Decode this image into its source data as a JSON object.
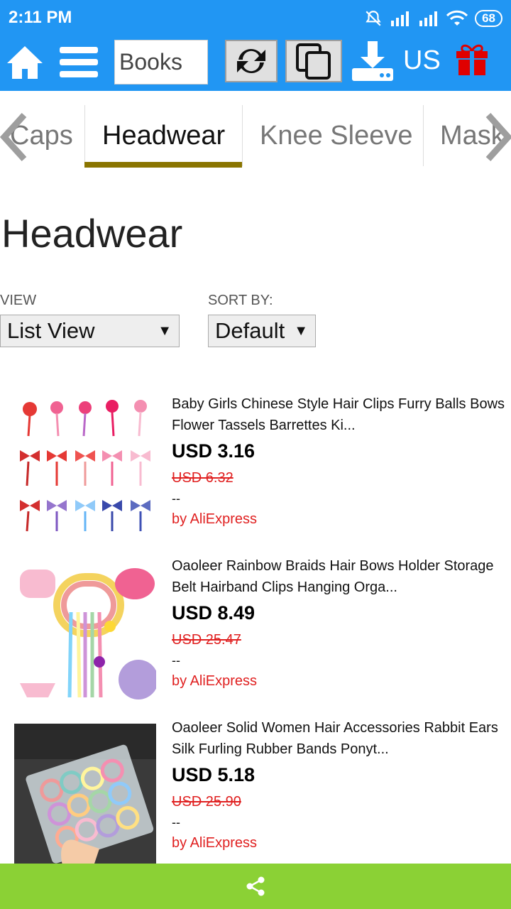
{
  "status_bar": {
    "time": "2:11 PM",
    "battery": "68"
  },
  "toolbar": {
    "search_value": "Books",
    "region": "US"
  },
  "tabs": [
    {
      "label": "Caps"
    },
    {
      "label": "Headwear"
    },
    {
      "label": "Knee Sleeve"
    },
    {
      "label": "Mask"
    }
  ],
  "page": {
    "title": "Headwear"
  },
  "controls": {
    "view_label": "VIEW",
    "view_value": "List View",
    "sort_label": "SORT BY:",
    "sort_value": "Default"
  },
  "products": [
    {
      "title": "Baby Girls Chinese Style Hair Clips Furry Balls Bows Flower Tassels Barrettes Ki...",
      "price": "USD 3.16",
      "old_price": "USD 6.32",
      "dash": "--",
      "seller": "by AliExpress"
    },
    {
      "title": "Oaoleer Rainbow Braids Hair Bows Holder Storage Belt Hairband Clips Hanging Orga...",
      "price": "USD 8.49",
      "old_price": "USD 25.47",
      "dash": "--",
      "seller": "by AliExpress"
    },
    {
      "title": "Oaoleer Solid Women Hair Accessories Rabbit Ears Silk Furling Rubber Bands Ponyt...",
      "price": "USD 5.18",
      "old_price": "USD 25.90",
      "dash": "--",
      "seller": "by AliExpress"
    }
  ],
  "colors": {
    "brand": "#2196f3",
    "accent": "#8a7500",
    "sale": "#e02020",
    "share_bar": "#8bd135"
  },
  "icons": [
    "home-icon",
    "menu-icon",
    "refresh-icon",
    "copy-icon",
    "download-icon",
    "gift-icon",
    "share-icon",
    "chevron-left-icon",
    "chevron-right-icon"
  ]
}
